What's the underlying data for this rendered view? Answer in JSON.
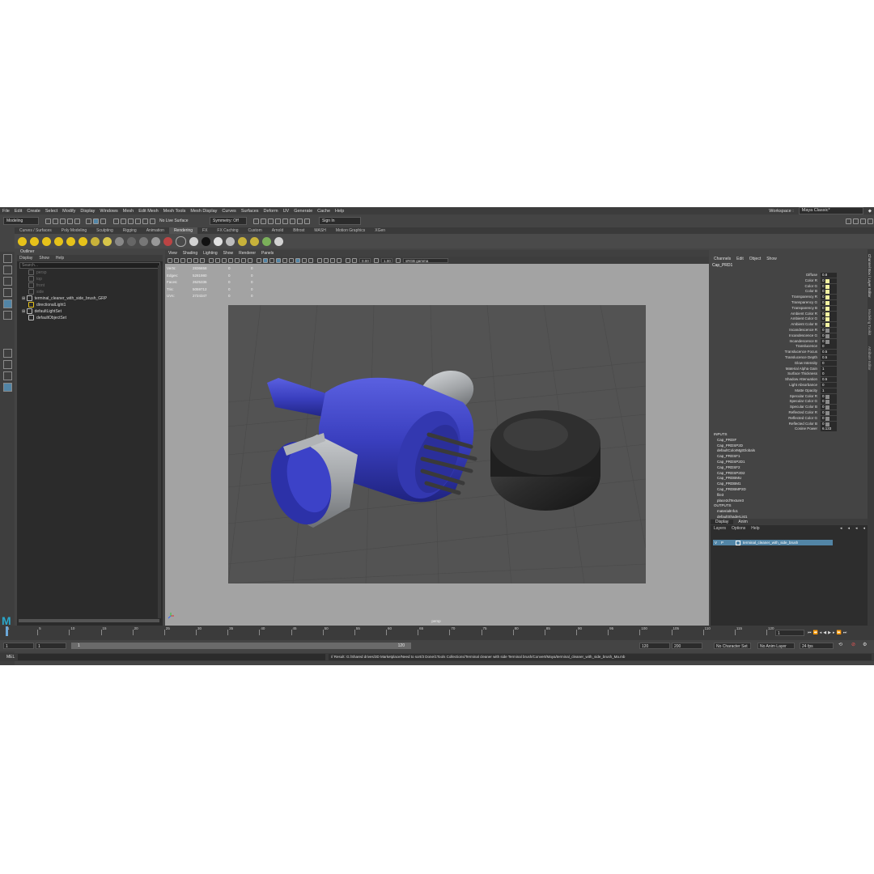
{
  "menubar": {
    "items": [
      "File",
      "Edit",
      "Create",
      "Select",
      "Modify",
      "Display",
      "Windows",
      "Mesh",
      "Edit Mesh",
      "Mesh Tools",
      "Mesh Display",
      "Curves",
      "Surfaces",
      "Deform",
      "UV",
      "Generate",
      "Cache",
      "Help"
    ],
    "workspace_label": "Workspace :",
    "workspace_value": "Maya Classic*"
  },
  "statusline": {
    "mode": "Modeling",
    "live_surface": "No Live Surface",
    "symmetry": "Symmetry: Off",
    "sign_in": "Sign In"
  },
  "shelf": {
    "tabs": [
      "Curves / Surfaces",
      "Poly Modeling",
      "Sculpting",
      "Rigging",
      "Animation",
      "Rendering",
      "FX",
      "FX Caching",
      "Custom",
      "Arnold",
      "Bifrost",
      "MASH",
      "Motion Graphics",
      "XGen"
    ],
    "active_tab": "Rendering"
  },
  "outliner": {
    "title": "Outliner",
    "menu": [
      "Display",
      "Show",
      "Help"
    ],
    "search_placeholder": "Search...",
    "items": [
      {
        "label": "persp",
        "dim": true
      },
      {
        "label": "top",
        "dim": true
      },
      {
        "label": "front",
        "dim": true
      },
      {
        "label": "side",
        "dim": true
      },
      {
        "label": "terminal_cleaner_with_side_brush_GRP",
        "dim": false
      },
      {
        "label": "directionalLight1",
        "dim": false
      },
      {
        "label": "defaultLightSet",
        "dim": false
      },
      {
        "label": "defaultObjectSet",
        "dim": false
      }
    ]
  },
  "viewport": {
    "menu": [
      "View",
      "Shading",
      "Lighting",
      "Show",
      "Renderer",
      "Panels"
    ],
    "exposure": "0.00",
    "gamma": "1.00",
    "color_space": "sRGB gamma",
    "camera_label": "persp",
    "hud": [
      {
        "key": "Verts:",
        "v1": "2836658",
        "v2": "0",
        "v3": "0"
      },
      {
        "key": "Edges:",
        "v1": "5281980",
        "v2": "0",
        "v3": "0"
      },
      {
        "key": "Faces:",
        "v1": "2625336",
        "v2": "0",
        "v3": "0"
      },
      {
        "key": "Tris:",
        "v1": "5059712",
        "v2": "0",
        "v3": "0"
      },
      {
        "key": "UVs:",
        "v1": "2724347",
        "v2": "0",
        "v3": "0"
      }
    ]
  },
  "channel_box": {
    "menu": [
      "Channels",
      "Edit",
      "Object",
      "Show"
    ],
    "node_name": "Cap_PRD1",
    "attributes": [
      {
        "label": "Diffuse",
        "value": "0.8"
      },
      {
        "label": "Color R",
        "value": "0"
      },
      {
        "label": "Color G",
        "value": "0"
      },
      {
        "label": "Color B",
        "value": "0"
      },
      {
        "label": "Transparency R",
        "value": "0"
      },
      {
        "label": "Transparency G",
        "value": "0"
      },
      {
        "label": "Transparency B",
        "value": "0"
      },
      {
        "label": "Ambient Color R",
        "value": "0"
      },
      {
        "label": "Ambient Color G",
        "value": "0"
      },
      {
        "label": "Ambient Color B",
        "value": "0"
      },
      {
        "label": "Incandescence R",
        "value": "0"
      },
      {
        "label": "Incandescence G",
        "value": "0"
      },
      {
        "label": "Incandescence B",
        "value": "0"
      },
      {
        "label": "Translucence",
        "value": "0"
      },
      {
        "label": "Translucence Focus",
        "value": "0.5"
      },
      {
        "label": "Translucence Depth",
        "value": "0.5"
      },
      {
        "label": "Glow Intensity",
        "value": "0"
      },
      {
        "label": "Material Alpha Gain",
        "value": "1"
      },
      {
        "label": "Surface Thickness",
        "value": "0"
      },
      {
        "label": "Shadow Attenuation",
        "value": "0.5"
      },
      {
        "label": "Light Absorbance",
        "value": "0"
      },
      {
        "label": "Matte Opacity",
        "value": "1"
      },
      {
        "label": "Specular Color R",
        "value": "0"
      },
      {
        "label": "Specular Color G",
        "value": "0"
      },
      {
        "label": "Specular Color B",
        "value": "0"
      },
      {
        "label": "Reflected Color R",
        "value": "0"
      },
      {
        "label": "Reflected Color G",
        "value": "0"
      },
      {
        "label": "Reflected Color B",
        "value": "0"
      },
      {
        "label": "Cosine Power",
        "value": "6.133"
      }
    ],
    "inputs_label": "INPUTS",
    "inputs": [
      "Cap_PRDIF",
      "Cap_PRDSP2D",
      "defaultColorMgtGlobals",
      "Cap_PRDSF1",
      "Cap_PRDSP2D1",
      "Cap_PRDSF2",
      "Cap_PRDSP2D2",
      "Cap_PRDBMU",
      "Cap_PRDBM1",
      "Cap_PRDBMP2D",
      "file3",
      "place2dTexture3"
    ],
    "outputs_label": "OUTPUTS",
    "outputs": [
      "materialInfo1",
      "defaultShaderList1"
    ]
  },
  "layer_editor": {
    "tabs": [
      "Display",
      "Anim"
    ],
    "menu": [
      "Layers",
      "Options",
      "Help"
    ],
    "layer_v": "V",
    "layer_p": "P",
    "layer_name": "terminal_cleaner_with_side_brush"
  },
  "side_tabs": [
    "Channel Box / Layer Editor",
    "Modeling Toolkit",
    "Attribute Editor"
  ],
  "time": {
    "ticks": [
      "1",
      "5",
      "10",
      "15",
      "20",
      "25",
      "30",
      "35",
      "40",
      "45",
      "50",
      "55",
      "60",
      "65",
      "70",
      "75",
      "80",
      "85",
      "90",
      "95",
      "100",
      "105",
      "110",
      "115",
      "120"
    ],
    "current_frame": "1",
    "start": "1",
    "playback_start": "1",
    "range_start_label": "1",
    "range_end_label": "120",
    "playback_end": "120",
    "end": "200",
    "character_set": "No Character Set",
    "anim_layer": "No Anim Layer",
    "fps": "24 fps"
  },
  "command_line": {
    "lang": "MEL",
    "result": "// Result: G:/Shared drives/3D Marketplace/Need to sort/3 Done/1Tools Collections/Terminal cleaner with side Terminal brush/Convert/Maya/terminal_cleaner_with_side_brush_Ma.mb"
  },
  "colors": {
    "accent": "#5285a6",
    "blue_body": "#3a3fbf",
    "metal": "#a0a3a6",
    "cap": "#2b2b2b"
  }
}
